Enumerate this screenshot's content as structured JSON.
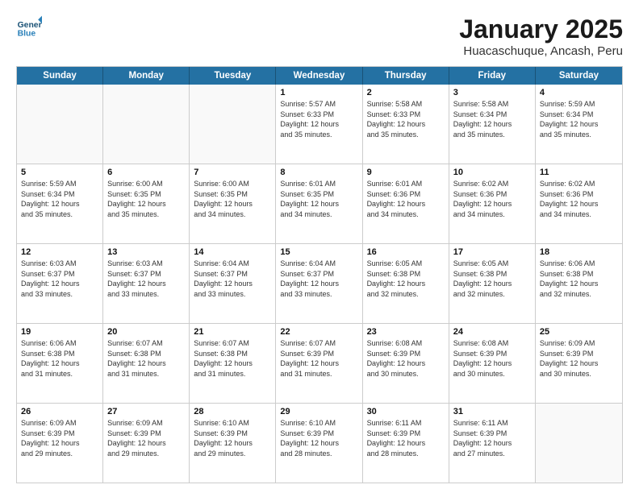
{
  "header": {
    "logo_line1": "General",
    "logo_line2": "Blue",
    "month": "January 2025",
    "location": "Huacaschuque, Ancash, Peru"
  },
  "days_of_week": [
    "Sunday",
    "Monday",
    "Tuesday",
    "Wednesday",
    "Thursday",
    "Friday",
    "Saturday"
  ],
  "weeks": [
    [
      {
        "day": "",
        "info": ""
      },
      {
        "day": "",
        "info": ""
      },
      {
        "day": "",
        "info": ""
      },
      {
        "day": "1",
        "info": "Sunrise: 5:57 AM\nSunset: 6:33 PM\nDaylight: 12 hours\nand 35 minutes."
      },
      {
        "day": "2",
        "info": "Sunrise: 5:58 AM\nSunset: 6:33 PM\nDaylight: 12 hours\nand 35 minutes."
      },
      {
        "day": "3",
        "info": "Sunrise: 5:58 AM\nSunset: 6:34 PM\nDaylight: 12 hours\nand 35 minutes."
      },
      {
        "day": "4",
        "info": "Sunrise: 5:59 AM\nSunset: 6:34 PM\nDaylight: 12 hours\nand 35 minutes."
      }
    ],
    [
      {
        "day": "5",
        "info": "Sunrise: 5:59 AM\nSunset: 6:34 PM\nDaylight: 12 hours\nand 35 minutes."
      },
      {
        "day": "6",
        "info": "Sunrise: 6:00 AM\nSunset: 6:35 PM\nDaylight: 12 hours\nand 35 minutes."
      },
      {
        "day": "7",
        "info": "Sunrise: 6:00 AM\nSunset: 6:35 PM\nDaylight: 12 hours\nand 34 minutes."
      },
      {
        "day": "8",
        "info": "Sunrise: 6:01 AM\nSunset: 6:35 PM\nDaylight: 12 hours\nand 34 minutes."
      },
      {
        "day": "9",
        "info": "Sunrise: 6:01 AM\nSunset: 6:36 PM\nDaylight: 12 hours\nand 34 minutes."
      },
      {
        "day": "10",
        "info": "Sunrise: 6:02 AM\nSunset: 6:36 PM\nDaylight: 12 hours\nand 34 minutes."
      },
      {
        "day": "11",
        "info": "Sunrise: 6:02 AM\nSunset: 6:36 PM\nDaylight: 12 hours\nand 34 minutes."
      }
    ],
    [
      {
        "day": "12",
        "info": "Sunrise: 6:03 AM\nSunset: 6:37 PM\nDaylight: 12 hours\nand 33 minutes."
      },
      {
        "day": "13",
        "info": "Sunrise: 6:03 AM\nSunset: 6:37 PM\nDaylight: 12 hours\nand 33 minutes."
      },
      {
        "day": "14",
        "info": "Sunrise: 6:04 AM\nSunset: 6:37 PM\nDaylight: 12 hours\nand 33 minutes."
      },
      {
        "day": "15",
        "info": "Sunrise: 6:04 AM\nSunset: 6:37 PM\nDaylight: 12 hours\nand 33 minutes."
      },
      {
        "day": "16",
        "info": "Sunrise: 6:05 AM\nSunset: 6:38 PM\nDaylight: 12 hours\nand 32 minutes."
      },
      {
        "day": "17",
        "info": "Sunrise: 6:05 AM\nSunset: 6:38 PM\nDaylight: 12 hours\nand 32 minutes."
      },
      {
        "day": "18",
        "info": "Sunrise: 6:06 AM\nSunset: 6:38 PM\nDaylight: 12 hours\nand 32 minutes."
      }
    ],
    [
      {
        "day": "19",
        "info": "Sunrise: 6:06 AM\nSunset: 6:38 PM\nDaylight: 12 hours\nand 31 minutes."
      },
      {
        "day": "20",
        "info": "Sunrise: 6:07 AM\nSunset: 6:38 PM\nDaylight: 12 hours\nand 31 minutes."
      },
      {
        "day": "21",
        "info": "Sunrise: 6:07 AM\nSunset: 6:38 PM\nDaylight: 12 hours\nand 31 minutes."
      },
      {
        "day": "22",
        "info": "Sunrise: 6:07 AM\nSunset: 6:39 PM\nDaylight: 12 hours\nand 31 minutes."
      },
      {
        "day": "23",
        "info": "Sunrise: 6:08 AM\nSunset: 6:39 PM\nDaylight: 12 hours\nand 30 minutes."
      },
      {
        "day": "24",
        "info": "Sunrise: 6:08 AM\nSunset: 6:39 PM\nDaylight: 12 hours\nand 30 minutes."
      },
      {
        "day": "25",
        "info": "Sunrise: 6:09 AM\nSunset: 6:39 PM\nDaylight: 12 hours\nand 30 minutes."
      }
    ],
    [
      {
        "day": "26",
        "info": "Sunrise: 6:09 AM\nSunset: 6:39 PM\nDaylight: 12 hours\nand 29 minutes."
      },
      {
        "day": "27",
        "info": "Sunrise: 6:09 AM\nSunset: 6:39 PM\nDaylight: 12 hours\nand 29 minutes."
      },
      {
        "day": "28",
        "info": "Sunrise: 6:10 AM\nSunset: 6:39 PM\nDaylight: 12 hours\nand 29 minutes."
      },
      {
        "day": "29",
        "info": "Sunrise: 6:10 AM\nSunset: 6:39 PM\nDaylight: 12 hours\nand 28 minutes."
      },
      {
        "day": "30",
        "info": "Sunrise: 6:11 AM\nSunset: 6:39 PM\nDaylight: 12 hours\nand 28 minutes."
      },
      {
        "day": "31",
        "info": "Sunrise: 6:11 AM\nSunset: 6:39 PM\nDaylight: 12 hours\nand 27 minutes."
      },
      {
        "day": "",
        "info": ""
      }
    ]
  ]
}
